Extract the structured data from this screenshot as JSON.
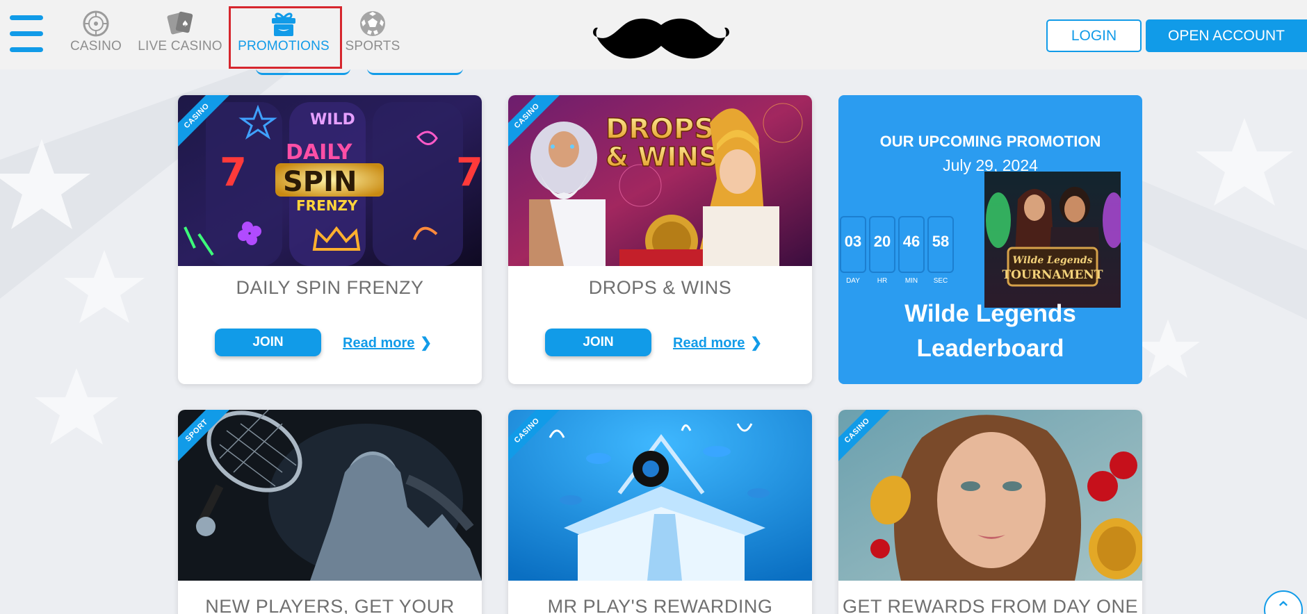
{
  "header": {
    "nav": [
      {
        "label": "CASINO",
        "icon": "roulette-icon"
      },
      {
        "label": "LIVE CASINO",
        "icon": "cards-icon"
      },
      {
        "label": "PROMOTIONS",
        "icon": "gift-icon"
      },
      {
        "label": "SPORTS",
        "icon": "soccer-ball-icon"
      }
    ],
    "login_label": "LOGIN",
    "open_account_label": "OPEN ACCOUNT",
    "accent_color": "#119be8",
    "highlight_color": "#d6262d"
  },
  "cards": [
    {
      "tag": "CASINO",
      "title": "DAILY SPIN FRENZY",
      "join_label": "JOIN",
      "readmore_label": "Read more",
      "art_text": [
        "WILD",
        "DAILY",
        "SPIN",
        "FRENZY"
      ]
    },
    {
      "tag": "CASINO",
      "title": "DROPS & WINS",
      "join_label": "JOIN",
      "readmore_label": "Read more",
      "art_text": [
        "DROPS",
        "& WINS"
      ]
    }
  ],
  "promo": {
    "heading": "OUR UPCOMING PROMOTION",
    "date": "July 29, 2024",
    "countdown": [
      {
        "value": "03",
        "label": "DAY"
      },
      {
        "value": "20",
        "label": "HR"
      },
      {
        "value": "46",
        "label": "MIN"
      },
      {
        "value": "58",
        "label": "SEC"
      }
    ],
    "tournament_text": [
      "Wilde Legends",
      "TOURNAMENT"
    ],
    "leaderboard_title_1": "Wilde Legends",
    "leaderboard_title_2": "Leaderboard"
  },
  "bottom_cards": [
    {
      "tag": "SPORT",
      "title": "NEW PLAYERS, GET YOUR"
    },
    {
      "tag": "CASINO",
      "title": "MR PLAY'S REWARDING"
    },
    {
      "tag": "CASINO",
      "title": "GET REWARDS FROM DAY ONE"
    }
  ]
}
